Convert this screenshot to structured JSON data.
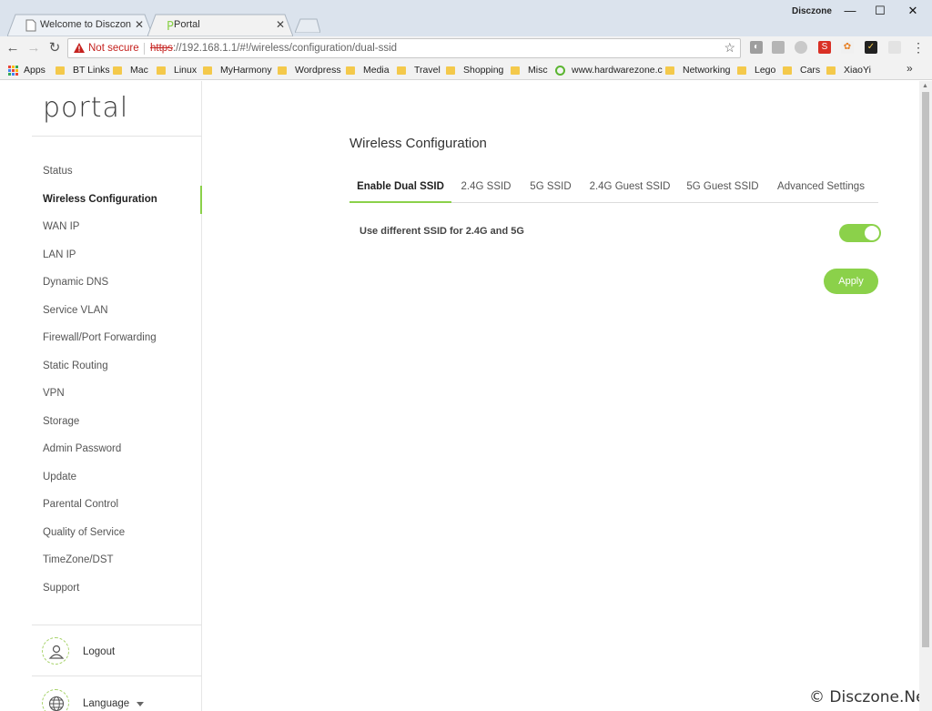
{
  "browser": {
    "tabs": [
      {
        "title": "Welcome to Disczone! -",
        "active": false
      },
      {
        "title": "Portal",
        "active": true
      }
    ],
    "window_user": "Disczone",
    "not_secure": "Not secure",
    "url_proto": "https",
    "url_rest": "://192.168.1.1/#!/wireless/configuration/dual-ssid",
    "bookmarks": [
      "Apps",
      "BT Links",
      "Mac",
      "Linux",
      "MyHarmony",
      "Wordpress",
      "Media",
      "Travel",
      "Shopping",
      "Misc",
      "www.hardwarezone.c",
      "Networking",
      "Lego",
      "Cars",
      "XiaoYi"
    ],
    "bookmarks_more": "»"
  },
  "sidebar": {
    "logo": "portal",
    "items": [
      "Status",
      "Wireless Configuration",
      "WAN IP",
      "LAN IP",
      "Dynamic DNS",
      "Service VLAN",
      "Firewall/Port Forwarding",
      "Static Routing",
      "VPN",
      "Storage",
      "Admin Password",
      "Update",
      "Parental Control",
      "Quality of Service",
      "TimeZone/DST",
      "Support"
    ],
    "active_index": 1,
    "logout": "Logout",
    "language": "Language"
  },
  "main": {
    "title": "Wireless Configuration",
    "tabs": [
      "Enable Dual SSID",
      "2.4G SSID",
      "5G SSID",
      "2.4G Guest SSID",
      "5G Guest SSID",
      "Advanced Settings"
    ],
    "active_tab": 0,
    "setting_label": "Use different SSID for 2.4G and 5G",
    "toggle_on": true,
    "apply": "Apply"
  },
  "watermark": "© Disczone.Net",
  "colors": {
    "accent": "#8bd14a",
    "warning": "#c5221f"
  }
}
